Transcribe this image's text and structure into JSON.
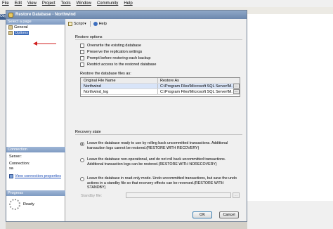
{
  "app": {
    "menu": [
      "File",
      "Edit",
      "View",
      "Project",
      "Tools",
      "Window",
      "Community",
      "Help"
    ],
    "left_panel_header": "Obje"
  },
  "dialog": {
    "title": "Restore Database - Northwind",
    "select_page_header": "Select a page",
    "pages": [
      {
        "label": "General",
        "selected": false
      },
      {
        "label": "Options",
        "selected": true
      }
    ],
    "connection": {
      "header": "Connection",
      "server_label": "Server:",
      "server_value": "",
      "connection_label": "Connection:",
      "connection_value": "sa",
      "view_properties_link": "View connection properties"
    },
    "progress": {
      "header": "Progress",
      "status": "Ready"
    },
    "toolbar": {
      "script_label": "Script",
      "help_label": "Help"
    },
    "restore_options": {
      "heading": "Restore options",
      "checkboxes": [
        {
          "label": "Overwrite the existing database",
          "checked": false
        },
        {
          "label": "Preserve the replication settings",
          "checked": false
        },
        {
          "label": "Prompt before restoring each backup",
          "checked": false
        },
        {
          "label": "Restrict access to the restored database",
          "checked": false
        }
      ]
    },
    "files_grid": {
      "caption": "Restore the database files as:",
      "columns": [
        "Original File Name",
        "Restore As"
      ],
      "rows": [
        {
          "original": "Northwind",
          "restore_as": "C:\\Program Files\\Microsoft SQL Server\\M...",
          "selected": true
        },
        {
          "original": "Northwind_log",
          "restore_as": "C:\\Program Files\\Microsoft SQL Server\\M...",
          "selected": false
        }
      ]
    },
    "recovery_state": {
      "heading": "Recovery state",
      "options": [
        {
          "text": "Leave the database ready to use by rolling back uncommitted transactions. Additional transaction logs cannot be restored.(RESTORE WITH RECOVERY)",
          "selected": true
        },
        {
          "text": "Leave the database non-operational, and do not roll back uncommitted transactions. Additional transaction logs can be restored.(RESTORE WITH NORECOVERY)",
          "selected": false
        },
        {
          "text": "Leave the database in read-only mode. Undo uncommitted transactions, but save the undo actions in a standby file so that recovery effects can be reversed.(RESTORE WITH STANDBY)",
          "selected": false
        }
      ],
      "standby_label": "Standby file:",
      "standby_value": "",
      "browse_label": "..."
    },
    "buttons": {
      "ok": "OK",
      "cancel": "Cancel"
    }
  }
}
